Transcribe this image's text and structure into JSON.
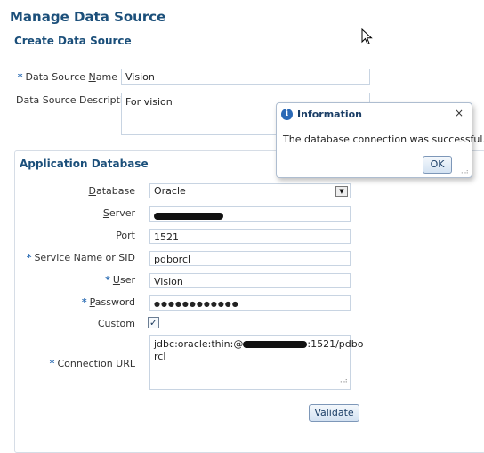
{
  "page": {
    "title": "Manage Data Source",
    "section_title": "Create Data Source"
  },
  "create": {
    "name_label_prefix": "Data Source ",
    "name_label_underlined": "N",
    "name_label_suffix": "ame",
    "name_value": "Vision",
    "desc_label": "Data Source Description",
    "desc_value": "For vision"
  },
  "app_db": {
    "title": "Application Database",
    "database_label": "Database",
    "database_value": "Oracle",
    "server_label": "Server",
    "port_label": "Port",
    "port_value": "1521",
    "service_label": "Service Name or SID",
    "service_value": "pdborcl",
    "user_label": "User",
    "user_value": "Vision",
    "password_label": "Password",
    "password_value": "●●●●●●●●●●●●",
    "custom_label": "Custom",
    "custom_checked": "✓",
    "url_label": "Connection URL",
    "url_prefix": "jdbc:oracle:thin:@",
    "url_suffix": ":1521/pdbo",
    "url_line2": "rcl",
    "validate_button": "Validate"
  },
  "dialog": {
    "title": "Information",
    "message": "The database connection was successful.",
    "ok_button": "OK",
    "close": "×",
    "icon": "i"
  },
  "colors": {
    "title": "#1b4f7a",
    "required_marker": "#2f6fb5"
  }
}
